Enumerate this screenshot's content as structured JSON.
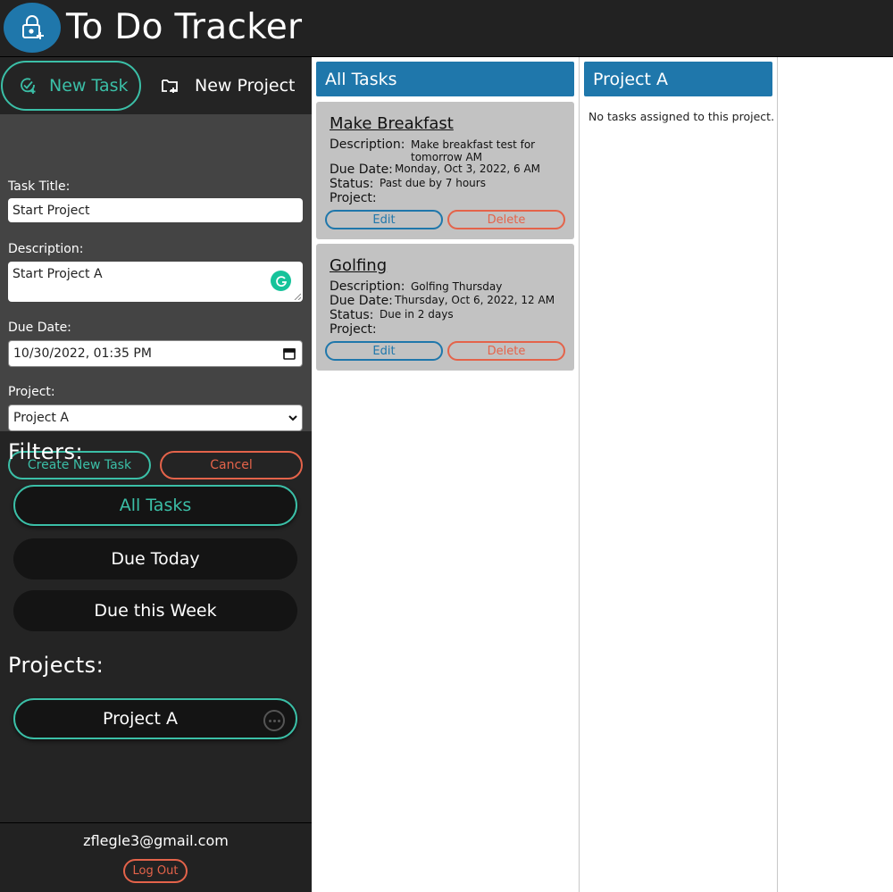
{
  "app": {
    "title": "To Do Tracker"
  },
  "tabs": {
    "new_task": "New Task",
    "new_project": "New Project"
  },
  "form": {
    "title_label": "Task Title:",
    "title_value": "Start Project",
    "description_label": "Description:",
    "description_value": "Start Project A",
    "due_label": "Due Date:",
    "due_value": "10/30/2022, 01:35 PM",
    "project_label": "Project:",
    "project_value": "Project A",
    "create_label": "Create New Task",
    "cancel_label": "Cancel"
  },
  "filters": {
    "heading": "Filters:",
    "items": [
      "All Tasks",
      "Due Today",
      "Due this Week"
    ]
  },
  "projects": {
    "heading": "Projects:",
    "items": [
      "Project A"
    ]
  },
  "footer": {
    "email": "zflegle3@gmail.com",
    "logout_label": "Log Out"
  },
  "all_tasks": {
    "heading": "All Tasks",
    "labels": {
      "description": "Description:",
      "due": "Due Date:",
      "status": "Status:",
      "project": "Project:",
      "edit": "Edit",
      "delete": "Delete"
    },
    "tasks": [
      {
        "title": "Make Breakfast",
        "description": "Make breakfast test for tomorrow AM",
        "due": "Monday, Oct 3, 2022, 6 AM",
        "status": "Past due by 7 hours",
        "project": ""
      },
      {
        "title": "Golfing",
        "description": "Golfing Thursday",
        "due": "Thursday, Oct 6, 2022, 12 AM",
        "status": "Due in 2 days",
        "project": ""
      }
    ]
  },
  "project_column": {
    "heading": "Project A",
    "empty_text": "No tasks assigned to this project."
  },
  "colors": {
    "accent_teal": "#3bbfa7",
    "accent_red": "#e4634a",
    "header_blue": "#1f77ab",
    "sidebar_bg": "#242424",
    "form_bg": "#444444"
  }
}
